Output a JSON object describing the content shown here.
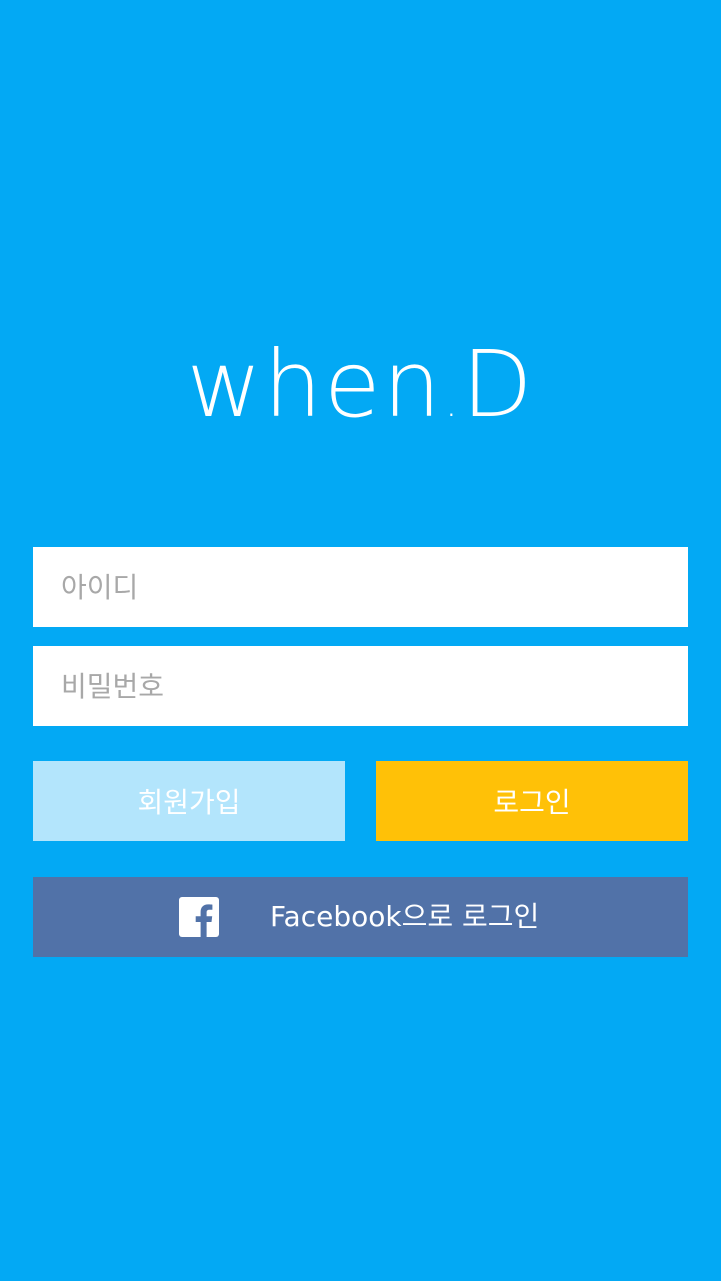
{
  "app": {
    "logo_text_main": "when",
    "logo_text_dot": ".",
    "logo_text_end": "D"
  },
  "form": {
    "username_placeholder": "아이디",
    "username_value": "",
    "password_placeholder": "비밀번호",
    "password_value": ""
  },
  "buttons": {
    "signup_label": "회원가입",
    "login_label": "로그인",
    "facebook_label": "Facebook으로 로그인"
  },
  "icons": {
    "facebook": "facebook-icon"
  },
  "colors": {
    "background": "#03a9f4",
    "signup": "#b3e5fc",
    "login": "#ffc107",
    "facebook": "#5172a8"
  }
}
